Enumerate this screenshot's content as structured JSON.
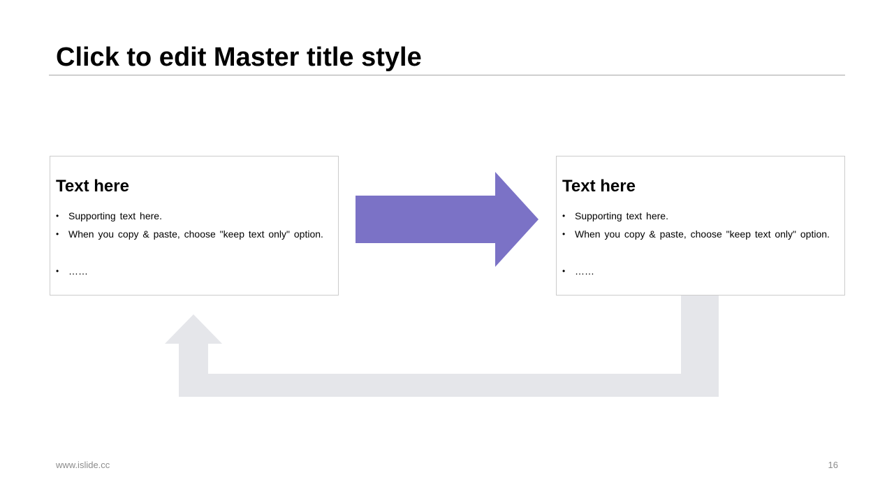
{
  "slide": {
    "title": "Click to edit Master title style",
    "footer_url": "www.islide.cc",
    "page_number": "16"
  },
  "colors": {
    "accent_arrow": "#7b72c6",
    "feedback_arrow": "#e5e6ea",
    "card_border": "#cccccc",
    "title_rule": "#a6a6a6",
    "footer_text": "#8c8c8c"
  },
  "cards": [
    {
      "heading": "Text here",
      "bullets": [
        "Supporting text here.",
        "When you copy & paste, choose \"keep text only\" option.",
        "……"
      ]
    },
    {
      "heading": "Text here",
      "bullets": [
        "Supporting text here.",
        "When you copy & paste, choose \"keep text only\" option.",
        "……"
      ]
    }
  ],
  "icons": {
    "forward_arrow": "arrow-right-icon",
    "feedback_arrow": "arrow-up-loop-icon"
  }
}
